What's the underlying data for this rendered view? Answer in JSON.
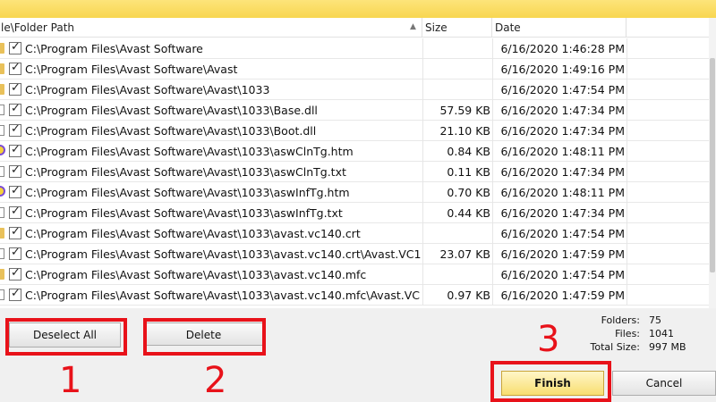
{
  "columns": {
    "path": "le\\Folder Path",
    "size": "Size",
    "date": "Date"
  },
  "rows": [
    {
      "icon": "folder",
      "path": "C:\\Program Files\\Avast Software",
      "size": "",
      "date": "6/16/2020 1:46:28 PM"
    },
    {
      "icon": "folder",
      "path": "C:\\Program Files\\Avast Software\\Avast",
      "size": "",
      "date": "6/16/2020 1:49:16 PM"
    },
    {
      "icon": "folder",
      "path": "C:\\Program Files\\Avast Software\\Avast\\1033",
      "size": "",
      "date": "6/16/2020 1:47:54 PM"
    },
    {
      "icon": "file",
      "path": "C:\\Program Files\\Avast Software\\Avast\\1033\\Base.dll",
      "size": "57.59 KB",
      "date": "6/16/2020 1:47:34 PM"
    },
    {
      "icon": "file",
      "path": "C:\\Program Files\\Avast Software\\Avast\\1033\\Boot.dll",
      "size": "21.10 KB",
      "date": "6/16/2020 1:47:34 PM"
    },
    {
      "icon": "html",
      "path": "C:\\Program Files\\Avast Software\\Avast\\1033\\aswClnTg.htm",
      "size": "0.84 KB",
      "date": "6/16/2020 1:48:11 PM"
    },
    {
      "icon": "file",
      "path": "C:\\Program Files\\Avast Software\\Avast\\1033\\aswClnTg.txt",
      "size": "0.11 KB",
      "date": "6/16/2020 1:47:34 PM"
    },
    {
      "icon": "html",
      "path": "C:\\Program Files\\Avast Software\\Avast\\1033\\aswInfTg.htm",
      "size": "0.70 KB",
      "date": "6/16/2020 1:48:11 PM"
    },
    {
      "icon": "file",
      "path": "C:\\Program Files\\Avast Software\\Avast\\1033\\aswInfTg.txt",
      "size": "0.44 KB",
      "date": "6/16/2020 1:47:34 PM"
    },
    {
      "icon": "folder",
      "path": "C:\\Program Files\\Avast Software\\Avast\\1033\\avast.vc140.crt",
      "size": "",
      "date": "6/16/2020 1:47:54 PM"
    },
    {
      "icon": "file",
      "path": "C:\\Program Files\\Avast Software\\Avast\\1033\\avast.vc140.crt\\Avast.VC1...",
      "size": "23.07 KB",
      "date": "6/16/2020 1:47:59 PM"
    },
    {
      "icon": "folder",
      "path": "C:\\Program Files\\Avast Software\\Avast\\1033\\avast.vc140.mfc",
      "size": "",
      "date": "6/16/2020 1:47:54 PM"
    },
    {
      "icon": "file",
      "path": "C:\\Program Files\\Avast Software\\Avast\\1033\\avast.vc140.mfc\\Avast.VC...",
      "size": "0.97 KB",
      "date": "6/16/2020 1:47:59 PM"
    }
  ],
  "buttons": {
    "deselect_all": "Deselect All",
    "delete": "Delete",
    "finish": "Finish",
    "cancel": "Cancel"
  },
  "stats": {
    "folders_label": "Folders:",
    "folders_value": "75",
    "files_label": "Files:",
    "files_value": "1041",
    "total_label": "Total Size:",
    "total_value": "997 MB"
  },
  "annotations": {
    "n1": "1",
    "n2": "2",
    "n3": "3"
  },
  "colors": {
    "highlight": "#e8121a",
    "finish_bg": "#f8de70",
    "titlebar": "#f8d650"
  }
}
